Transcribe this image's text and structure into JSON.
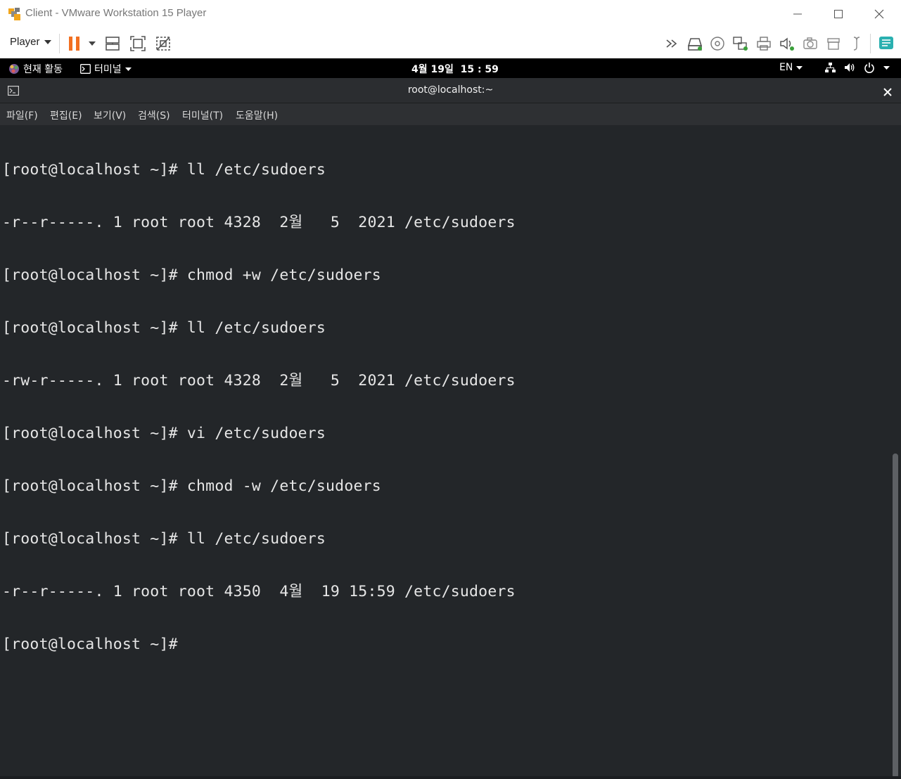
{
  "window": {
    "title": "Client - VMware Workstation 15 Player"
  },
  "toolbar": {
    "player_label": "Player",
    "icons": [
      "pause-icon",
      "dropdown-arrow-icon",
      "send-ctrl-alt-del-icon",
      "fullscreen-icon",
      "unity-icon",
      "more-icon",
      "hard-disk-icon",
      "cd-dvd-icon",
      "network-adapter-icon",
      "printer-icon",
      "sound-card-icon",
      "camera-icon",
      "usb-controller-icon",
      "display-icon",
      "message-log-icon"
    ]
  },
  "gnome": {
    "activities": "현재 활동",
    "app_menu": "터미널",
    "clock": "4월 19일  15 : 59",
    "input_lang": "EN"
  },
  "terminal": {
    "title": "root@localhost:~",
    "menu": [
      "파일(F)",
      "편집(E)",
      "보기(V)",
      "검색(S)",
      "터미널(T)",
      "도움말(H)"
    ],
    "lines": [
      "[root@localhost ~]# ll /etc/sudoers",
      "-r--r-----. 1 root root 4328  2월   5  2021 /etc/sudoers",
      "[root@localhost ~]# chmod +w /etc/sudoers",
      "[root@localhost ~]# ll /etc/sudoers",
      "-rw-r-----. 1 root root 4328  2월   5  2021 /etc/sudoers",
      "[root@localhost ~]# vi /etc/sudoers",
      "[root@localhost ~]# chmod -w /etc/sudoers",
      "[root@localhost ~]# ll /etc/sudoers",
      "-r--r-----. 1 root root 4350  4월  19 15:59 /etc/sudoers",
      "[root@localhost ~]#"
    ]
  },
  "colors": {
    "terminal_bg": "#232629",
    "terminal_fg": "#e6e6e6",
    "pause_orange": "#f26f21",
    "gnome_bar": "#000000"
  }
}
